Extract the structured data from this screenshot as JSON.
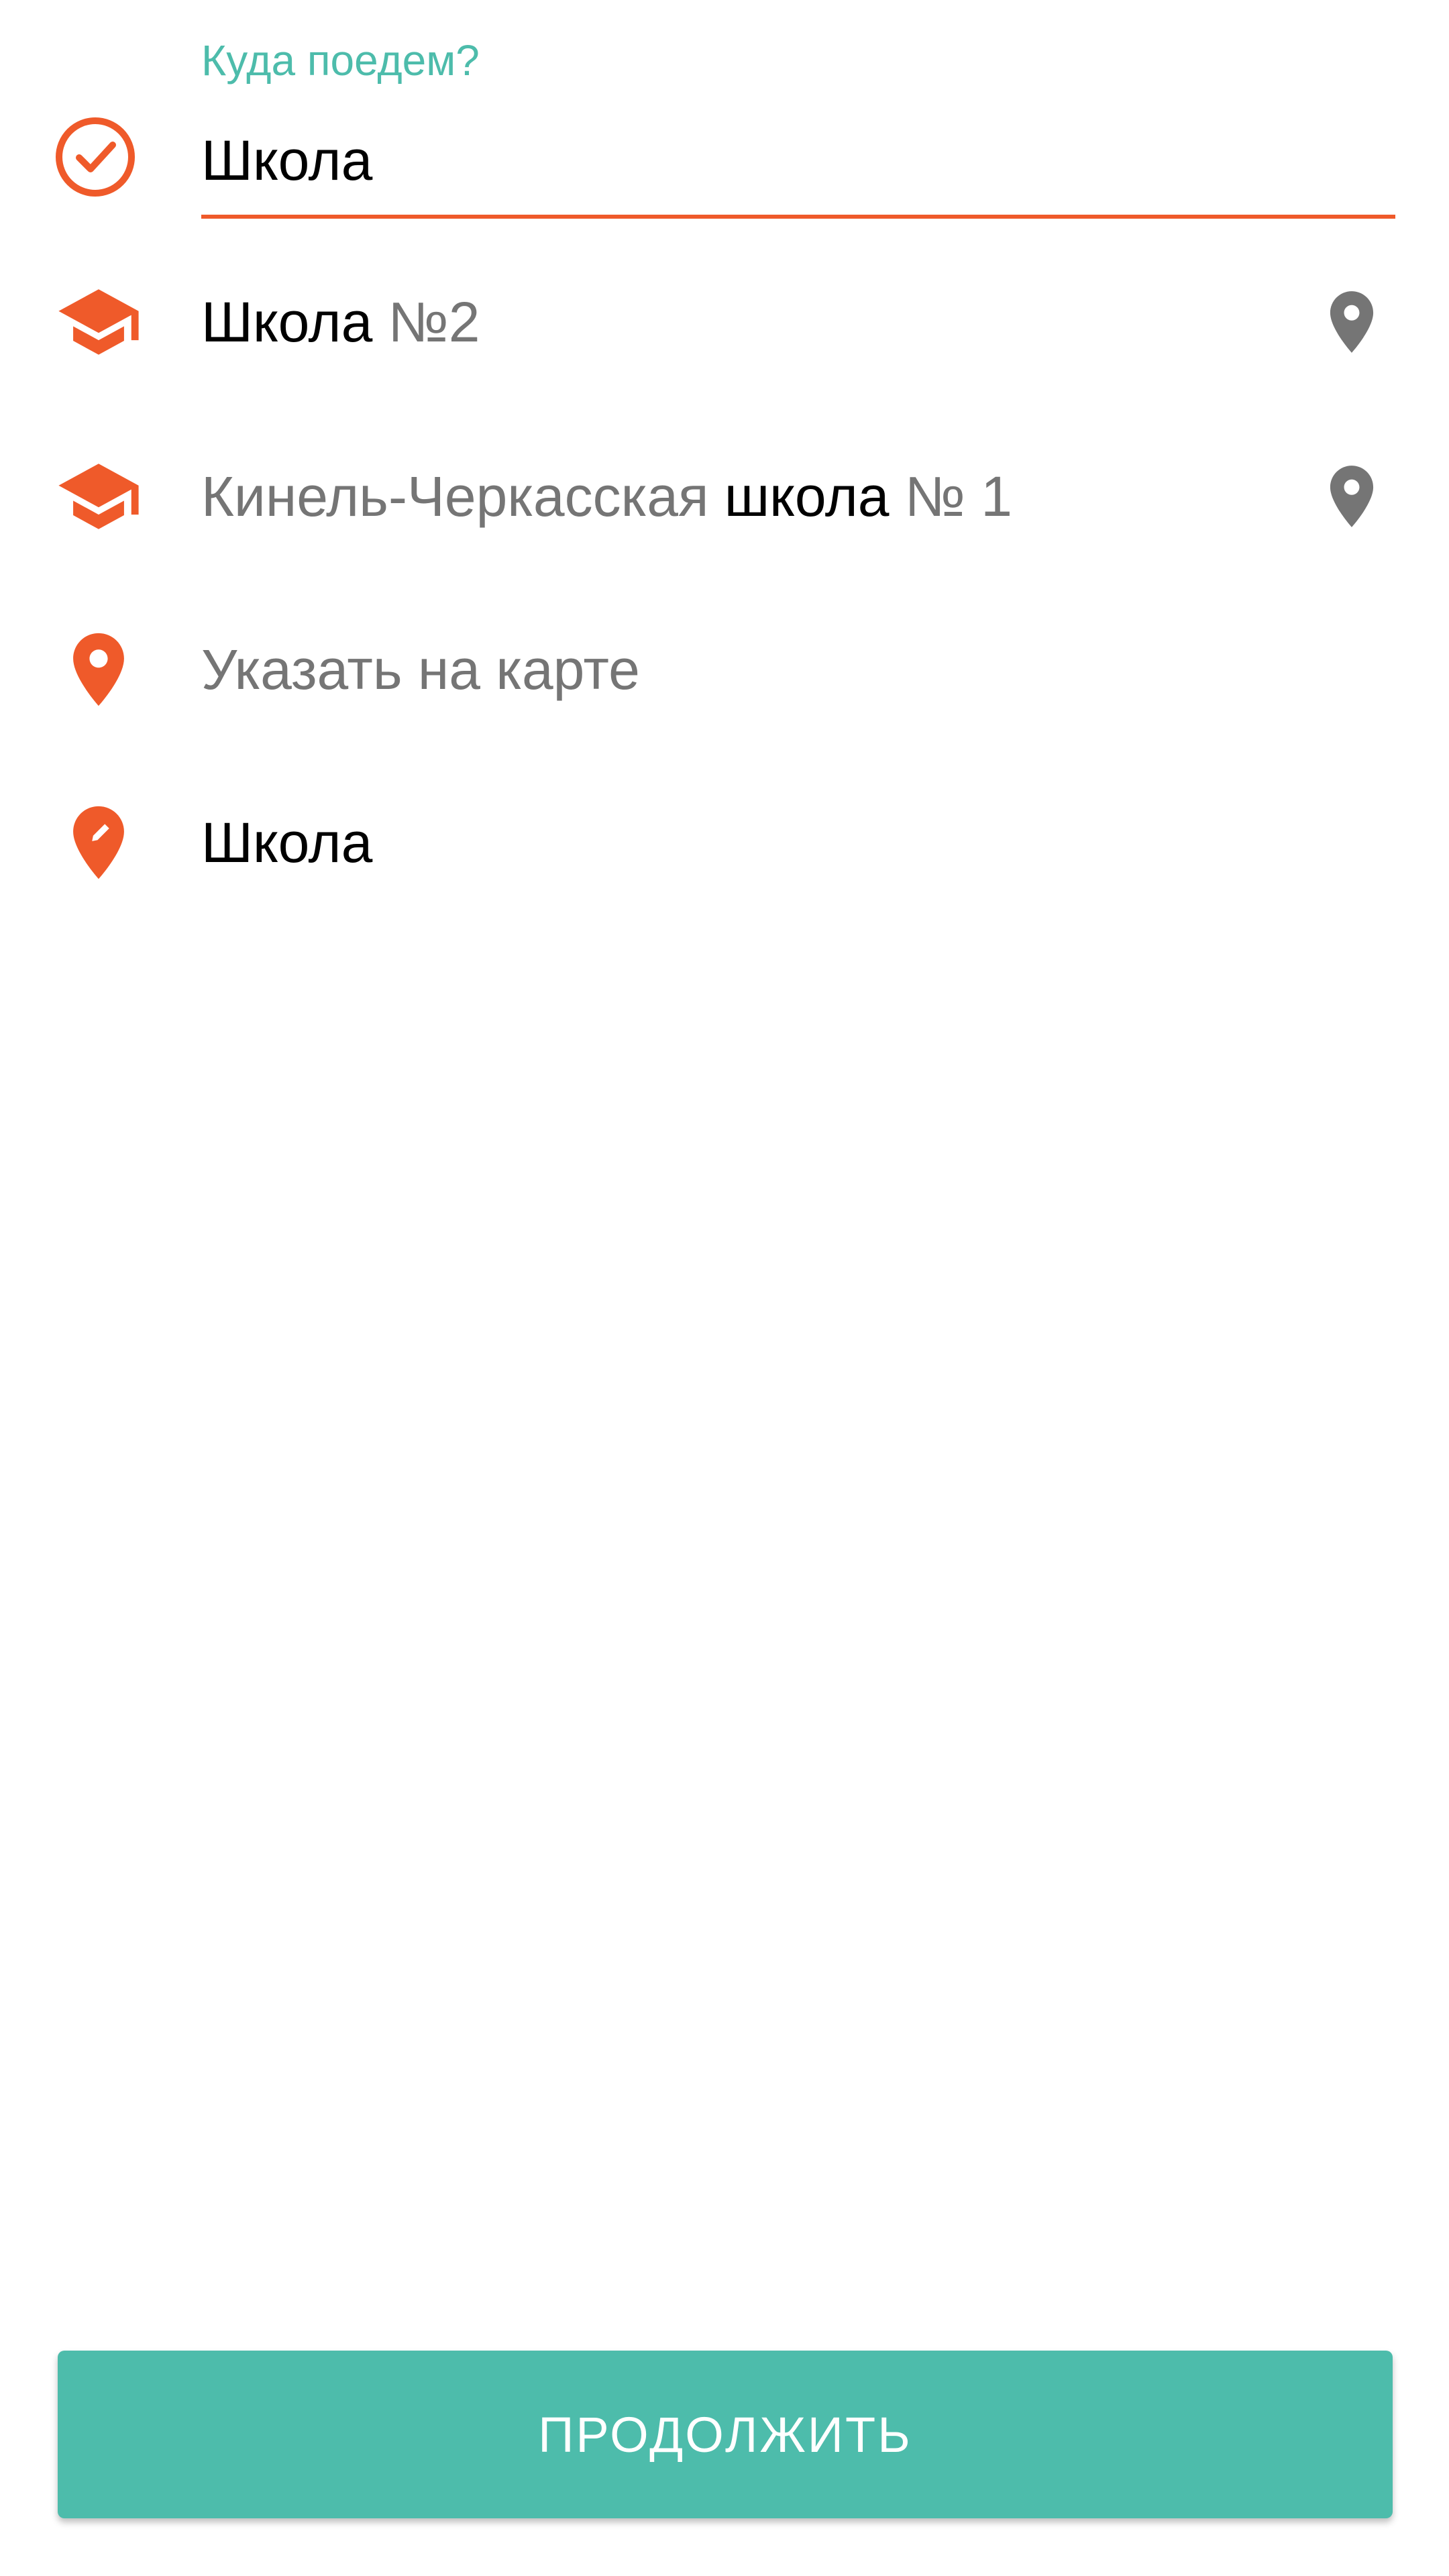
{
  "destination": {
    "label": "Куда поедем?",
    "value": "Школа"
  },
  "suggestions": [
    {
      "icon": "graduation-cap-icon",
      "match": "Школа",
      "rest": " №2",
      "trailing_icon": "map-pin-icon"
    },
    {
      "icon": "graduation-cap-icon",
      "prefix": "Кинель-Черкасская ",
      "match": "школа",
      "rest": " № 1",
      "trailing_icon": "map-pin-icon"
    }
  ],
  "actions": {
    "pick_on_map": "Указать на карте",
    "custom_address": "Школа"
  },
  "button": {
    "continue": "ПРОДОЛЖИТЬ"
  },
  "colors": {
    "accent": "#ef5a2a",
    "teal": "#4dbcab",
    "muted_text": "#757575",
    "gray_icon": "#757575"
  }
}
